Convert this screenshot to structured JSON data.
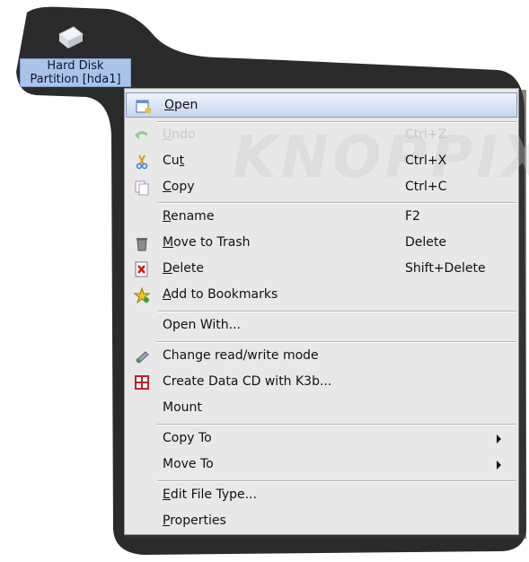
{
  "desktop": {
    "icon_label_line1": "Hard Disk",
    "icon_label_line2": "Partition [hda1]",
    "icon": "hard-disk-icon",
    "colors": {
      "background": "#2a2a2a",
      "label_bg": "#a9c4e8"
    }
  },
  "menu": {
    "watermark": "KNOPPIX",
    "items": [
      {
        "label": "Open",
        "accel": "O",
        "shortcut": "",
        "icon": "open-icon",
        "state": "highlighted"
      },
      {
        "label": "Undo",
        "accel": "U",
        "shortcut": "Ctrl+Z",
        "icon": "undo-icon",
        "state": "disabled"
      },
      {
        "label": "Cut",
        "accel": "t",
        "shortcut": "Ctrl+X",
        "icon": "cut-icon",
        "state": "normal"
      },
      {
        "label": "Copy",
        "accel": "C",
        "shortcut": "Ctrl+C",
        "icon": "copy-icon",
        "state": "normal"
      },
      {
        "label": "Rename",
        "accel": "R",
        "shortcut": "F2",
        "icon": "",
        "state": "normal"
      },
      {
        "label": "Move to Trash",
        "accel": "M",
        "shortcut": "Delete",
        "icon": "trash-icon",
        "state": "normal"
      },
      {
        "label": "Delete",
        "accel": "D",
        "shortcut": "Shift+Delete",
        "icon": "delete-icon",
        "state": "normal"
      },
      {
        "label": "Add to Bookmarks",
        "accel": "A",
        "shortcut": "",
        "icon": "bookmark-star-icon",
        "state": "normal"
      },
      {
        "label": "Open With...",
        "accel": "",
        "shortcut": "",
        "icon": "",
        "state": "normal"
      },
      {
        "label": "Change read/write mode",
        "accel": "",
        "shortcut": "",
        "icon": "rw-mode-icon",
        "state": "normal"
      },
      {
        "label": "Create Data CD with K3b...",
        "accel": "",
        "shortcut": "",
        "icon": "k3b-icon",
        "state": "normal"
      },
      {
        "label": "Mount",
        "accel": "",
        "shortcut": "",
        "icon": "",
        "state": "normal"
      },
      {
        "label": "Copy To",
        "accel": "",
        "shortcut": "",
        "icon": "",
        "state": "submenu"
      },
      {
        "label": "Move To",
        "accel": "",
        "shortcut": "",
        "icon": "",
        "state": "submenu"
      },
      {
        "label": "Edit File Type...",
        "accel": "E",
        "shortcut": "",
        "icon": "",
        "state": "normal"
      },
      {
        "label": "Properties",
        "accel": "P",
        "shortcut": "",
        "icon": "",
        "state": "normal"
      }
    ]
  }
}
